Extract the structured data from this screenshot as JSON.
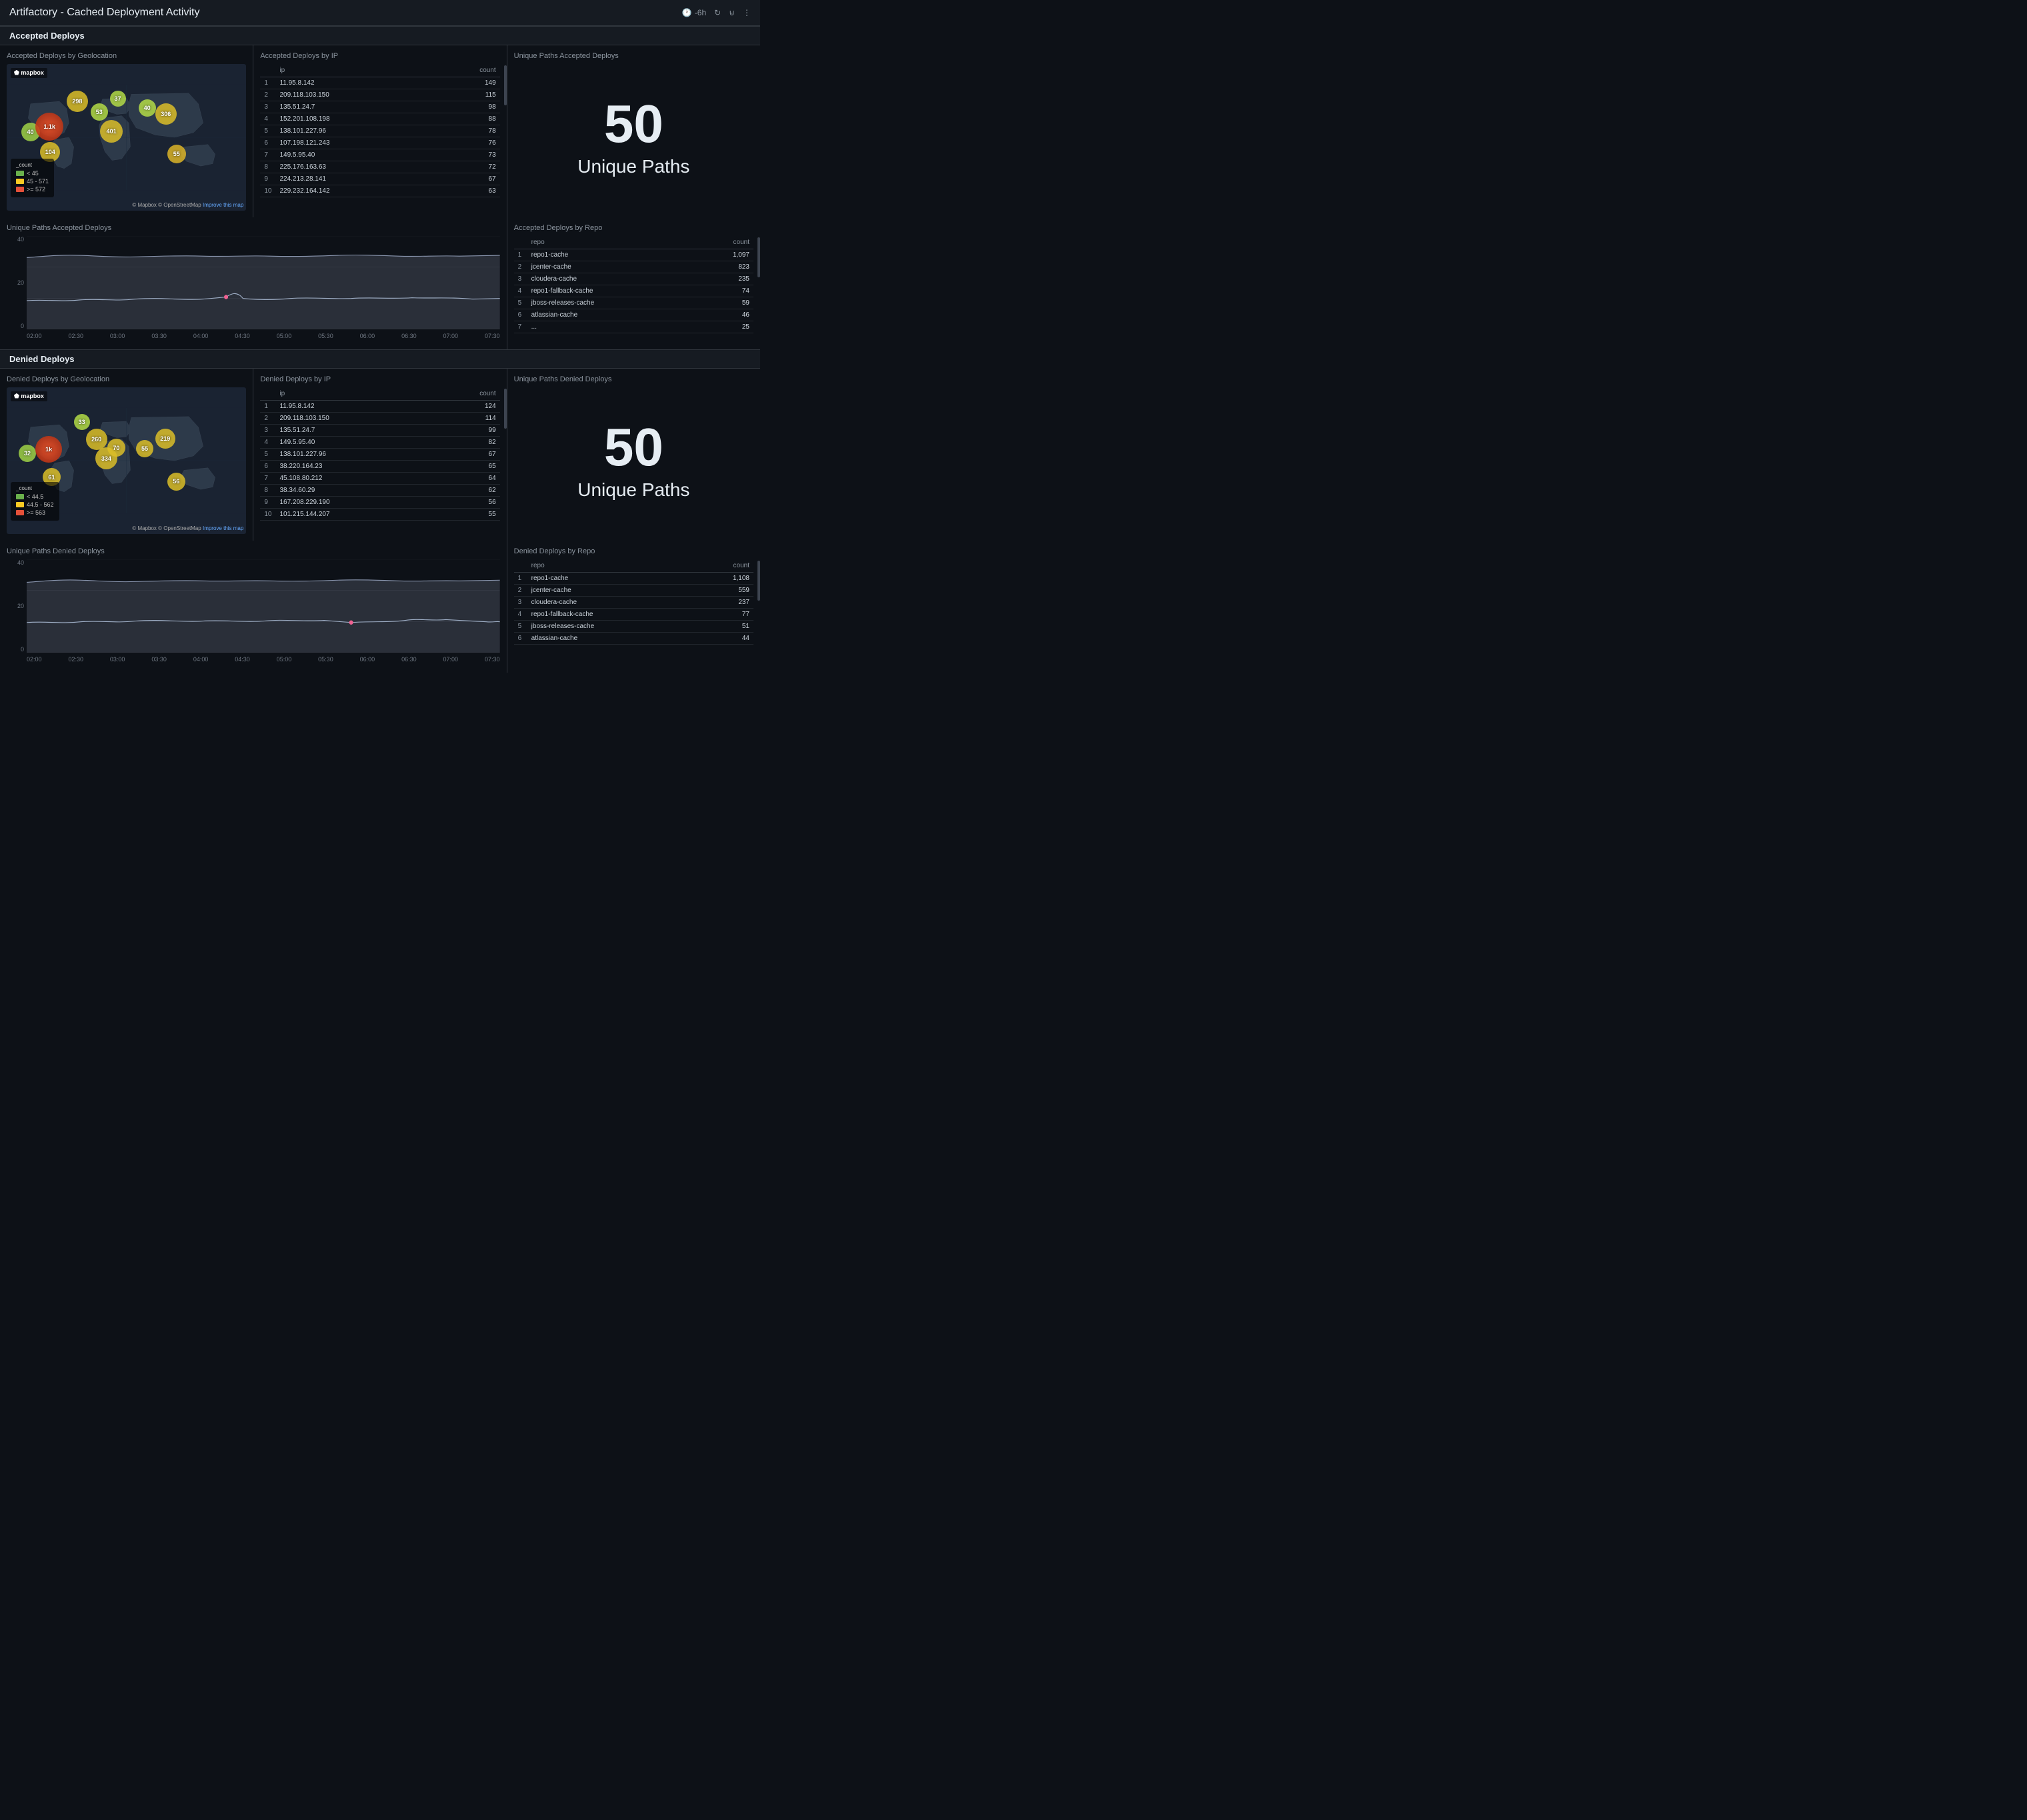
{
  "header": {
    "title": "Artifactory - Cached Deployment Activity",
    "time_range": "-6h",
    "controls": [
      "time-icon",
      "refresh-icon",
      "filter-icon",
      "menu-icon"
    ]
  },
  "sections": {
    "accepted": {
      "label": "Accepted Deploys",
      "geolocation": {
        "title": "Accepted Deploys by Geolocation",
        "legend": {
          "label": "_count",
          "items": [
            {
              "color": "#6ab04c",
              "text": "< 45"
            },
            {
              "color": "#f9ca24",
              "text": "45 - 571"
            },
            {
              "color": "#e55039",
              "text": ">= 572"
            }
          ]
        },
        "bubbles": [
          {
            "x": 6,
            "y": 42,
            "label": "40",
            "size": 28,
            "color": "rgba(180,220,80,0.85)"
          },
          {
            "x": 13,
            "y": 38,
            "label": "1.1k",
            "size": 38,
            "color": "rgba(220,60,30,0.9)"
          },
          {
            "x": 14,
            "y": 58,
            "label": "104",
            "size": 30,
            "color": "rgba(220,200,50,0.85)"
          },
          {
            "x": 26,
            "y": 22,
            "label": "298",
            "size": 32,
            "color": "rgba(220,200,50,0.85)"
          },
          {
            "x": 36,
            "y": 33,
            "label": "53",
            "size": 26,
            "color": "rgba(180,220,80,0.85)"
          },
          {
            "x": 45,
            "y": 28,
            "label": "37",
            "size": 24,
            "color": "rgba(180,220,80,0.85)"
          },
          {
            "x": 40,
            "y": 42,
            "label": "401",
            "size": 33,
            "color": "rgba(220,200,50,0.85)"
          },
          {
            "x": 56,
            "y": 30,
            "label": "40",
            "size": 26,
            "color": "rgba(180,220,80,0.85)"
          },
          {
            "x": 63,
            "y": 33,
            "label": "306",
            "size": 32,
            "color": "rgba(220,200,50,0.85)"
          },
          {
            "x": 68,
            "y": 62,
            "label": "55",
            "size": 28,
            "color": "rgba(220,200,50,0.85)"
          }
        ]
      },
      "ip_table": {
        "title": "Accepted Deploys by IP",
        "headers": [
          "",
          "ip",
          "count"
        ],
        "rows": [
          {
            "n": 1,
            "ip": "11.95.8.142",
            "count": "149"
          },
          {
            "n": 2,
            "ip": "209.118.103.150",
            "count": "115"
          },
          {
            "n": 3,
            "ip": "135.51.24.7",
            "count": "98"
          },
          {
            "n": 4,
            "ip": "152.201.108.198",
            "count": "88"
          },
          {
            "n": 5,
            "ip": "138.101.227.96",
            "count": "78"
          },
          {
            "n": 6,
            "ip": "107.198.121.243",
            "count": "76"
          },
          {
            "n": 7,
            "ip": "149.5.95.40",
            "count": "73"
          },
          {
            "n": 8,
            "ip": "225.176.163.63",
            "count": "72"
          },
          {
            "n": 9,
            "ip": "224.213.28.141",
            "count": "67"
          },
          {
            "n": 10,
            "ip": "229.232.164.142",
            "count": "63"
          }
        ]
      },
      "unique_paths": {
        "title": "Unique Paths Accepted Deploys",
        "number": "50",
        "label": "Unique Paths"
      },
      "timeseries": {
        "title": "Unique Paths Accepted Deploys",
        "yaxis": [
          "40",
          "",
          "20",
          "",
          "0"
        ],
        "xaxis": [
          "02:00",
          "02:30",
          "03:00",
          "03:30",
          "04:00",
          "04:30",
          "05:00",
          "05:30",
          "06:00",
          "06:30",
          "07:00",
          "07:30"
        ]
      },
      "repo_table": {
        "title": "Accepted Deploys by Repo",
        "headers": [
          "",
          "repo",
          "count"
        ],
        "rows": [
          {
            "n": 1,
            "repo": "repo1-cache",
            "count": "1,097"
          },
          {
            "n": 2,
            "repo": "jcenter-cache",
            "count": "823"
          },
          {
            "n": 3,
            "repo": "cloudera-cache",
            "count": "235"
          },
          {
            "n": 4,
            "repo": "repo1-fallback-cache",
            "count": "74"
          },
          {
            "n": 5,
            "repo": "jboss-releases-cache",
            "count": "59"
          },
          {
            "n": 6,
            "repo": "atlassian-cache",
            "count": "46"
          },
          {
            "n": 7,
            "repo": "...",
            "count": "25"
          }
        ]
      }
    },
    "denied": {
      "label": "Denied Deploys",
      "geolocation": {
        "title": "Denied Deploys by Geolocation",
        "legend": {
          "label": "_count",
          "items": [
            {
              "color": "#6ab04c",
              "text": "< 44.5"
            },
            {
              "color": "#f9ca24",
              "text": "44.5 - 562"
            },
            {
              "color": "#e55039",
              "text": ">= 563"
            }
          ]
        },
        "bubbles": [
          {
            "x": 5,
            "y": 43,
            "label": "32",
            "size": 26,
            "color": "rgba(180,220,80,0.85)"
          },
          {
            "x": 13,
            "y": 38,
            "label": "1k",
            "size": 36,
            "color": "rgba(220,60,30,0.9)"
          },
          {
            "x": 16,
            "y": 60,
            "label": "61",
            "size": 27,
            "color": "rgba(220,200,50,0.85)"
          },
          {
            "x": 29,
            "y": 22,
            "label": "33",
            "size": 24,
            "color": "rgba(180,220,80,0.85)"
          },
          {
            "x": 34,
            "y": 32,
            "label": "260",
            "size": 31,
            "color": "rgba(220,200,50,0.85)"
          },
          {
            "x": 37,
            "y": 43,
            "label": "334",
            "size": 32,
            "color": "rgba(220,200,50,0.85)"
          },
          {
            "x": 43,
            "y": 38,
            "label": "70",
            "size": 27,
            "color": "rgba(220,200,50,0.85)"
          },
          {
            "x": 55,
            "y": 38,
            "label": "55",
            "size": 26,
            "color": "rgba(220,200,50,0.85)"
          },
          {
            "x": 63,
            "y": 32,
            "label": "219",
            "size": 30,
            "color": "rgba(220,200,50,0.85)"
          },
          {
            "x": 68,
            "y": 63,
            "label": "56",
            "size": 27,
            "color": "rgba(220,200,50,0.85)"
          }
        ]
      },
      "ip_table": {
        "title": "Denied Deploys by IP",
        "headers": [
          "",
          "ip",
          "count"
        ],
        "rows": [
          {
            "n": 1,
            "ip": "11.95.8.142",
            "count": "124"
          },
          {
            "n": 2,
            "ip": "209.118.103.150",
            "count": "114"
          },
          {
            "n": 3,
            "ip": "135.51.24.7",
            "count": "99"
          },
          {
            "n": 4,
            "ip": "149.5.95.40",
            "count": "82"
          },
          {
            "n": 5,
            "ip": "138.101.227.96",
            "count": "67"
          },
          {
            "n": 6,
            "ip": "38.220.164.23",
            "count": "65"
          },
          {
            "n": 7,
            "ip": "45.108.80.212",
            "count": "64"
          },
          {
            "n": 8,
            "ip": "38.34.60.29",
            "count": "62"
          },
          {
            "n": 9,
            "ip": "167.208.229.190",
            "count": "56"
          },
          {
            "n": 10,
            "ip": "101.215.144.207",
            "count": "55"
          }
        ]
      },
      "unique_paths": {
        "title": "Unique Paths Denied Deploys",
        "number": "50",
        "label": "Unique Paths"
      },
      "timeseries": {
        "title": "Unique Paths Denied Deploys",
        "yaxis": [
          "40",
          "",
          "20",
          "",
          "0"
        ],
        "xaxis": [
          "02:00",
          "02:30",
          "03:00",
          "03:30",
          "04:00",
          "04:30",
          "05:00",
          "05:30",
          "06:00",
          "06:30",
          "07:00",
          "07:30"
        ]
      },
      "repo_table": {
        "title": "Denied Deploys by Repo",
        "headers": [
          "",
          "repo",
          "count"
        ],
        "rows": [
          {
            "n": 1,
            "repo": "repo1-cache",
            "count": "1,108"
          },
          {
            "n": 2,
            "repo": "jcenter-cache",
            "count": "559"
          },
          {
            "n": 3,
            "repo": "cloudera-cache",
            "count": "237"
          },
          {
            "n": 4,
            "repo": "repo1-fallback-cache",
            "count": "77"
          },
          {
            "n": 5,
            "repo": "jboss-releases-cache",
            "count": "51"
          },
          {
            "n": 6,
            "repo": "atlassian-cache",
            "count": "44"
          }
        ]
      }
    }
  }
}
